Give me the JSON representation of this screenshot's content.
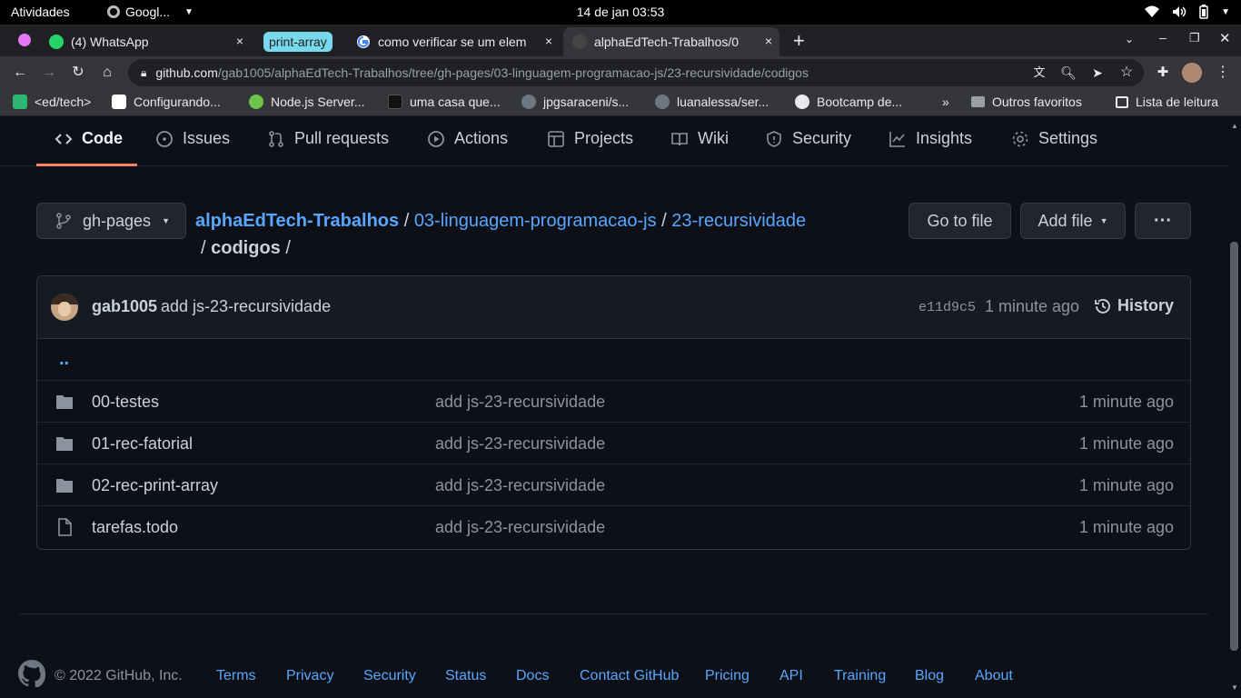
{
  "os": {
    "activities": "Atividades",
    "app_label": "Googl...",
    "clock": "14 de jan  03:53"
  },
  "tabs": [
    {
      "label": "(4) WhatsApp",
      "close": "×"
    },
    {
      "group": "print-array"
    },
    {
      "label": "como verificar se um elem",
      "close": "×"
    },
    {
      "label": "alphaEdTech-Trabalhos/0",
      "close": "×"
    }
  ],
  "new_tab": "+",
  "toolbar": {
    "url_host": "github.com",
    "url_path": "/gab1005/alphaEdTech-Trabalhos/tree/gh-pages/03-linguagem-programacao-js/23-recursividade/codigos"
  },
  "bookmarks": [
    {
      "label": "<ed/tech>",
      "color": "#2bb673"
    },
    {
      "label": "Configurando...",
      "color": "#ffffff"
    },
    {
      "label": "Node.js Server...",
      "color": "#6cc24a"
    },
    {
      "label": "uma casa que...",
      "color": "#111111"
    },
    {
      "label": "jpgsaraceni/s...",
      "color": "#6e7681"
    },
    {
      "label": "luanalessa/ser...",
      "color": "#6e7681"
    },
    {
      "label": "Bootcamp de...",
      "color": "#e8eaed"
    }
  ],
  "bookmarks_more": "»",
  "bookmarks_other": "Outros favoritos",
  "bookmarks_reading": "Lista de leitura",
  "reponav": [
    "Code",
    "Issues",
    "Pull requests",
    "Actions",
    "Projects",
    "Wiki",
    "Security",
    "Insights",
    "Settings"
  ],
  "branch": "gh-pages",
  "breadcrumb": {
    "repo": "alphaEdTech-Trabalhos",
    "sep": "/",
    "dir1": "03-linguagem-programacao-js",
    "dir2": "23-recursividade",
    "current": "codigos",
    "trail": "/"
  },
  "buttons": {
    "go_to_file": "Go to file",
    "add_file": "Add file",
    "more": "···"
  },
  "commit": {
    "author": "gab1005",
    "message": "add js-23-recursividade",
    "sha": "e11d9c5",
    "age": "1 minute ago",
    "history": "History"
  },
  "parent_dir": "..",
  "files": [
    {
      "name": "00-testes",
      "type": "dir",
      "message": "add js-23-recursividade",
      "age": "1 minute ago"
    },
    {
      "name": "01-rec-fatorial",
      "type": "dir",
      "message": "add js-23-recursividade",
      "age": "1 minute ago"
    },
    {
      "name": "02-rec-print-array",
      "type": "dir",
      "message": "add js-23-recursividade",
      "age": "1 minute ago"
    },
    {
      "name": "tarefas.todo",
      "type": "file",
      "message": "add js-23-recursividade",
      "age": "1 minute ago"
    }
  ],
  "footer": {
    "copyright": "© 2022 GitHub, Inc.",
    "links": [
      "Terms",
      "Privacy",
      "Security",
      "Status",
      "Docs",
      "Contact GitHub",
      "Pricing",
      "API",
      "Training",
      "Blog",
      "About"
    ]
  },
  "colors": {
    "accent_link": "#58a6ff",
    "tab_group": "#78d9ec",
    "nav_underline": "#f78166",
    "whatsapp": "#25d366",
    "tab_purple": "#e477f3"
  }
}
